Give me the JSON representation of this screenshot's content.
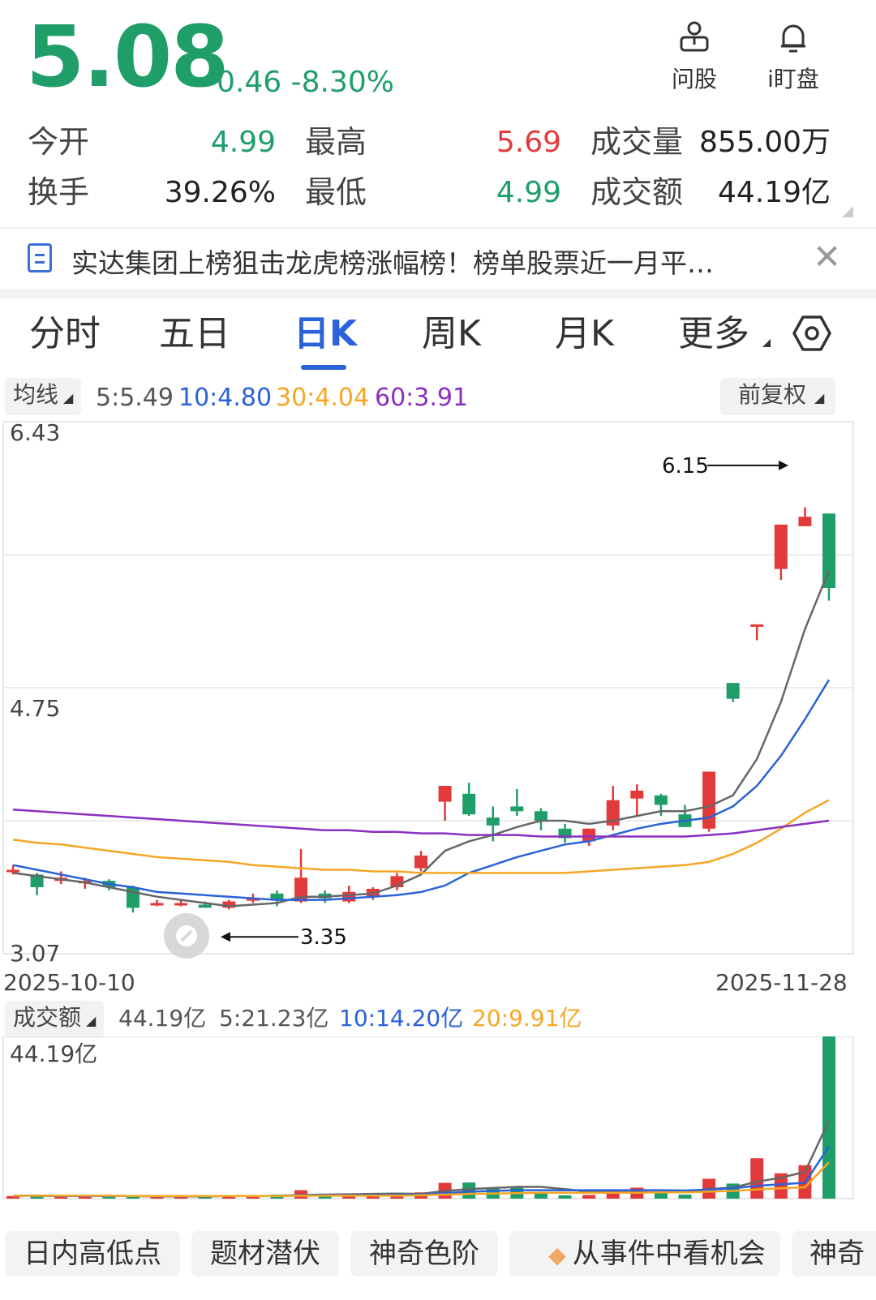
{
  "quote": {
    "price": "5.08",
    "change": "-0.46",
    "change_pct": "-8.30%",
    "colors": {
      "down": "#1f9e6a",
      "up": "#e23a3a"
    }
  },
  "top_actions": [
    {
      "label": "问股",
      "icon": "user-board-icon"
    },
    {
      "label": "i盯盘",
      "icon": "bell-icon"
    }
  ],
  "stats": {
    "open_label": "今开",
    "open": "4.99",
    "high_label": "最高",
    "high": "5.69",
    "volume_label": "成交量",
    "volume": "855.00万",
    "turnover_label": "换手",
    "turnover": "39.26%",
    "low_label": "最低",
    "low": "4.99",
    "amount_label": "成交额",
    "amount": "44.19亿"
  },
  "news": {
    "text": "实达集团上榜狙击龙虎榜涨幅榜！榜单股票近一月平…",
    "icon": "document-icon",
    "close_icon": "close-icon"
  },
  "tabs": {
    "t1": "分时",
    "t2": "五日",
    "t3": "日K",
    "t4": "周K",
    "t5": "月K",
    "t6": "更多",
    "settings_icon": "hexagon-settings-icon"
  },
  "ma_bar": {
    "toggle": "均线",
    "ma5": "5:5.49",
    "ma10": "10:4.80",
    "ma30": "30:4.04",
    "ma60": "60:3.91",
    "adjust": "前复权",
    "colors": {
      "ma5": "#666666",
      "ma10": "#2a62d8",
      "ma30": "#f5a623",
      "ma60": "#8a2fc0"
    }
  },
  "price_axis": {
    "top": "6.43",
    "mid": "4.75",
    "bottom": "3.07"
  },
  "date_axis": {
    "start": "2025-10-10",
    "end": "2025-11-28"
  },
  "volume_bar": {
    "toggle": "成交额",
    "current": "44.19亿",
    "ma5": "5:21.23亿",
    "ma10": "10:14.20亿",
    "ma20": "20:9.91亿",
    "axis_top": "44.19亿"
  },
  "chart_data": {
    "type": "candlestick",
    "x_range": [
      "2025-10-10",
      "2025-11-28"
    ],
    "ylim": [
      3.07,
      6.43
    ],
    "annotations": {
      "max": "6.15",
      "min": "3.35"
    },
    "candles": [
      {
        "o": 3.6,
        "h": 3.63,
        "l": 3.57,
        "c": 3.6
      },
      {
        "o": 3.57,
        "h": 3.58,
        "l": 3.44,
        "c": 3.49
      },
      {
        "o": 3.53,
        "h": 3.59,
        "l": 3.51,
        "c": 3.55
      },
      {
        "o": 3.53,
        "h": 3.55,
        "l": 3.48,
        "c": 3.53
      },
      {
        "o": 3.53,
        "h": 3.54,
        "l": 3.47,
        "c": 3.49
      },
      {
        "o": 3.49,
        "h": 3.5,
        "l": 3.33,
        "c": 3.36
      },
      {
        "o": 3.38,
        "h": 3.41,
        "l": 3.37,
        "c": 3.39
      },
      {
        "o": 3.39,
        "h": 3.41,
        "l": 3.37,
        "c": 3.39
      },
      {
        "o": 3.38,
        "h": 3.4,
        "l": 3.36,
        "c": 3.36
      },
      {
        "o": 3.36,
        "h": 3.41,
        "l": 3.35,
        "c": 3.4
      },
      {
        "o": 3.41,
        "h": 3.45,
        "l": 3.39,
        "c": 3.42
      },
      {
        "o": 3.45,
        "h": 3.47,
        "l": 3.37,
        "c": 3.41
      },
      {
        "o": 3.4,
        "h": 3.73,
        "l": 3.39,
        "c": 3.55
      },
      {
        "o": 3.45,
        "h": 3.47,
        "l": 3.39,
        "c": 3.42
      },
      {
        "o": 3.4,
        "h": 3.5,
        "l": 3.39,
        "c": 3.46
      },
      {
        "o": 3.43,
        "h": 3.49,
        "l": 3.41,
        "c": 3.48
      },
      {
        "o": 3.49,
        "h": 3.58,
        "l": 3.47,
        "c": 3.56
      },
      {
        "o": 3.61,
        "h": 3.72,
        "l": 3.59,
        "c": 3.69
      },
      {
        "o": 4.03,
        "h": 4.12,
        "l": 3.91,
        "c": 4.13
      },
      {
        "o": 4.08,
        "h": 4.15,
        "l": 3.94,
        "c": 3.95
      },
      {
        "o": 3.93,
        "h": 4.0,
        "l": 3.78,
        "c": 3.88
      },
      {
        "o": 4.0,
        "h": 4.11,
        "l": 3.94,
        "c": 3.97
      },
      {
        "o": 3.97,
        "h": 3.99,
        "l": 3.85,
        "c": 3.91
      },
      {
        "o": 3.86,
        "h": 3.89,
        "l": 3.77,
        "c": 3.8
      },
      {
        "o": 3.78,
        "h": 3.86,
        "l": 3.75,
        "c": 3.86
      },
      {
        "o": 3.88,
        "h": 4.13,
        "l": 3.85,
        "c": 4.04
      },
      {
        "o": 4.05,
        "h": 4.14,
        "l": 3.94,
        "c": 4.1
      },
      {
        "o": 4.07,
        "h": 4.08,
        "l": 3.94,
        "c": 4.01
      },
      {
        "o": 3.95,
        "h": 4.01,
        "l": 3.87,
        "c": 3.87
      },
      {
        "o": 3.86,
        "h": 4.22,
        "l": 3.84,
        "c": 4.22
      },
      {
        "o": 4.78,
        "h": 4.78,
        "l": 4.66,
        "c": 4.68
      },
      {
        "o": 5.15,
        "h": 5.15,
        "l": 5.05,
        "c": 5.15
      },
      {
        "o": 5.5,
        "h": 5.69,
        "l": 5.43,
        "c": 5.78
      },
      {
        "o": 5.77,
        "h": 5.89,
        "l": 6.04,
        "c": 5.83
      },
      {
        "o": 5.85,
        "h": 5.85,
        "l": 5.3,
        "c": 5.38
      }
    ],
    "series": [
      {
        "name": "5",
        "color": "#666666",
        "values": [
          3.58,
          3.56,
          3.54,
          3.52,
          3.49,
          3.46,
          3.43,
          3.41,
          3.39,
          3.37,
          3.38,
          3.39,
          3.43,
          3.43,
          3.44,
          3.45,
          3.5,
          3.57,
          3.72,
          3.78,
          3.82,
          3.87,
          3.91,
          3.91,
          3.89,
          3.91,
          3.94,
          3.97,
          3.97,
          4.0,
          4.07,
          4.3,
          4.66,
          5.12,
          5.49
        ]
      },
      {
        "name": "10",
        "color": "#2a62d8",
        "values": [
          3.63,
          3.6,
          3.57,
          3.54,
          3.51,
          3.49,
          3.46,
          3.45,
          3.44,
          3.43,
          3.42,
          3.41,
          3.41,
          3.41,
          3.42,
          3.43,
          3.44,
          3.46,
          3.5,
          3.58,
          3.63,
          3.68,
          3.72,
          3.76,
          3.78,
          3.82,
          3.86,
          3.89,
          3.91,
          3.93,
          4.0,
          4.13,
          4.32,
          4.55,
          4.8
        ]
      },
      {
        "name": "30",
        "color": "#f5a623",
        "values": [
          3.79,
          3.77,
          3.76,
          3.74,
          3.72,
          3.7,
          3.68,
          3.67,
          3.66,
          3.65,
          3.63,
          3.62,
          3.61,
          3.6,
          3.6,
          3.59,
          3.59,
          3.58,
          3.58,
          3.58,
          3.58,
          3.58,
          3.58,
          3.58,
          3.59,
          3.6,
          3.61,
          3.62,
          3.63,
          3.65,
          3.7,
          3.77,
          3.86,
          3.96,
          4.04
        ]
      },
      {
        "name": "60",
        "color": "#8a2fc0",
        "values": [
          3.98,
          3.97,
          3.96,
          3.95,
          3.94,
          3.93,
          3.92,
          3.91,
          3.9,
          3.89,
          3.88,
          3.87,
          3.86,
          3.85,
          3.85,
          3.84,
          3.84,
          3.83,
          3.83,
          3.82,
          3.82,
          3.82,
          3.81,
          3.81,
          3.81,
          3.81,
          3.81,
          3.81,
          3.81,
          3.82,
          3.83,
          3.85,
          3.87,
          3.89,
          3.91
        ]
      }
    ],
    "volume": {
      "unit": "亿",
      "values": [
        0.7,
        0.8,
        0.6,
        0.6,
        0.6,
        0.7,
        0.6,
        0.6,
        0.7,
        0.8,
        0.7,
        1.1,
        2.3,
        1.1,
        1.2,
        1.1,
        1.3,
        1.7,
        4.3,
        4.4,
        2.8,
        3.0,
        1.7,
        0.9,
        1.0,
        2.1,
        3.0,
        1.6,
        1.1,
        5.4,
        4.1,
        11.0,
        6.9,
        9.1,
        44.19
      ],
      "ma": [
        {
          "name": "5",
          "values": [
            0.8,
            0.8,
            0.7,
            0.7,
            0.7,
            0.7,
            0.6,
            0.6,
            0.6,
            0.7,
            0.7,
            0.7,
            1.0,
            1.1,
            1.2,
            1.3,
            1.4,
            1.3,
            2.1,
            2.6,
            2.9,
            3.2,
            3.2,
            2.6,
            1.9,
            1.7,
            1.7,
            1.7,
            1.8,
            2.6,
            3.0,
            4.6,
            5.7,
            7.3,
            21.23
          ]
        },
        {
          "name": "10",
          "values": [
            0.8,
            0.8,
            0.7,
            0.7,
            0.7,
            0.7,
            0.7,
            0.7,
            0.7,
            0.7,
            0.7,
            0.7,
            0.9,
            0.9,
            0.9,
            1.0,
            1.0,
            1.1,
            1.5,
            1.9,
            2.1,
            2.3,
            2.3,
            2.3,
            2.3,
            2.3,
            2.3,
            2.3,
            2.2,
            2.5,
            2.8,
            3.5,
            3.9,
            4.3,
            14.2
          ]
        },
        {
          "name": "20",
          "values": [
            0.8,
            0.8,
            0.8,
            0.8,
            0.8,
            0.7,
            0.7,
            0.7,
            0.7,
            0.7,
            0.7,
            0.7,
            0.8,
            0.8,
            0.8,
            0.8,
            0.8,
            0.9,
            1.1,
            1.3,
            1.4,
            1.5,
            1.6,
            1.6,
            1.6,
            1.6,
            1.6,
            1.7,
            1.7,
            1.9,
            2.1,
            2.5,
            2.8,
            3.1,
            9.91
          ]
        }
      ]
    }
  },
  "bottom_chips": [
    "日内高低点",
    "题材潜伏",
    "神奇色阶",
    "从事件中看机会",
    "神奇"
  ]
}
